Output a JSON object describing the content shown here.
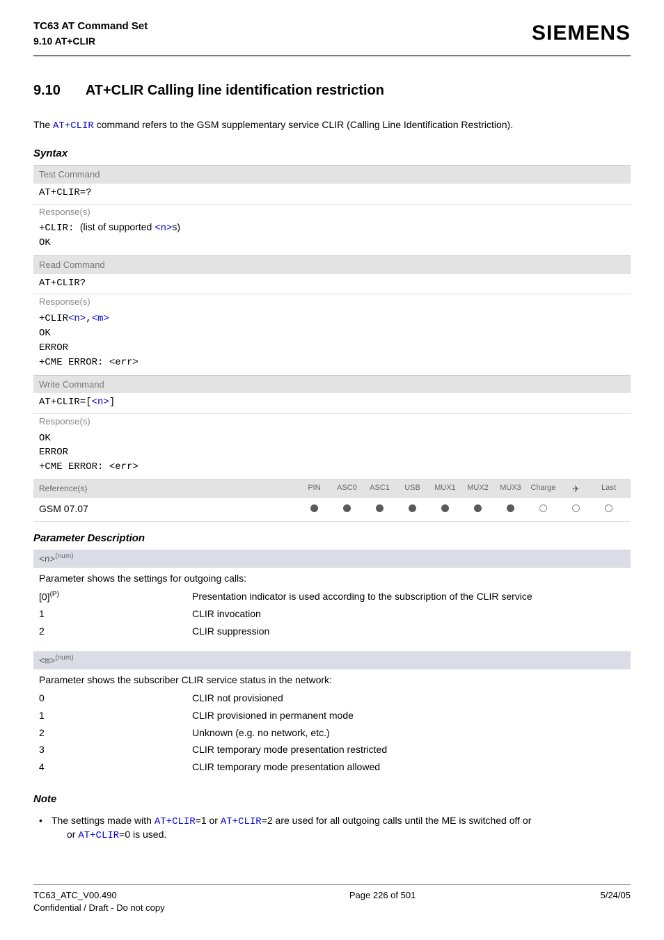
{
  "header": {
    "title": "TC63 AT Command Set",
    "subtitle": "9.10 AT+CLIR",
    "brand": "SIEMENS"
  },
  "section": {
    "number": "9.10",
    "title": "AT+CLIR   Calling line identification restriction"
  },
  "intro": {
    "pre": "The ",
    "cmd": "AT+CLIR",
    "post": " command refers to the GSM supplementary service CLIR (Calling Line Identification Restriction)."
  },
  "labels": {
    "syntax": "Syntax",
    "test_cmd": "Test Command",
    "read_cmd": "Read Command",
    "write_cmd": "Write Command",
    "responses": "Response(s)",
    "references": "Reference(s)",
    "param_desc": "Parameter Description",
    "note": "Note"
  },
  "test": {
    "cmd": "AT+CLIR=?",
    "resp_prefix": "+CLIR: ",
    "resp_text1": "(list of supported ",
    "resp_param": "<n>",
    "resp_text2": "s)",
    "ok": "OK"
  },
  "read": {
    "cmd": "AT+CLIR?",
    "resp_prefix": "+CLIR",
    "p1": "<n>",
    "comma": ",",
    "p2": "<m>",
    "ok": "OK",
    "error": "ERROR",
    "cme": "+CME ERROR: <err>"
  },
  "write": {
    "cmd_pre": "AT+CLIR=",
    "cmd_b1": "[",
    "cmd_param": "<n>",
    "cmd_b2": "]",
    "ok": "OK",
    "error": "ERROR",
    "cme": "+CME ERROR: <err>"
  },
  "ref": {
    "cols": [
      "PIN",
      "ASC0",
      "ASC1",
      "USB",
      "MUX1",
      "MUX2",
      "MUX3",
      "Charge",
      "✈",
      "Last"
    ],
    "value": "GSM 07.07",
    "dots": [
      "filled",
      "filled",
      "filled",
      "filled",
      "filled",
      "filled",
      "filled",
      "empty",
      "empty",
      "empty"
    ]
  },
  "param_n": {
    "name": "<n>",
    "type": "(num)",
    "desc": "Parameter shows the settings for outgoing calls:",
    "rows": [
      {
        "v": "[0]",
        "sup": "(P)",
        "m": "Presentation indicator is used according to the subscription of the CLIR service"
      },
      {
        "v": "1",
        "sup": "",
        "m": "CLIR invocation"
      },
      {
        "v": "2",
        "sup": "",
        "m": "CLIR suppression"
      }
    ]
  },
  "param_m": {
    "name": "<m>",
    "type": "(num)",
    "desc": "Parameter shows the subscriber CLIR service status in the network:",
    "rows": [
      {
        "v": "0",
        "m": "CLIR not provisioned"
      },
      {
        "v": "1",
        "m": "CLIR provisioned in permanent mode"
      },
      {
        "v": "2",
        "m": "Unknown (e.g. no network, etc.)"
      },
      {
        "v": "3",
        "m": "CLIR temporary mode presentation restricted"
      },
      {
        "v": "4",
        "m": "CLIR temporary mode presentation allowed"
      }
    ]
  },
  "note": {
    "t1": "The settings made with ",
    "c1": "AT+CLIR",
    "t2": "=1 or ",
    "c2": "AT+CLIR",
    "t3": "=2 are used for all outgoing calls until the ME is switched off or ",
    "c3": "AT+CLIR",
    "t4": "=0 is used."
  },
  "footer": {
    "left1": "TC63_ATC_V00.490",
    "left2": "Confidential / Draft - Do not copy",
    "center": "Page 226 of 501",
    "right": "5/24/05"
  }
}
